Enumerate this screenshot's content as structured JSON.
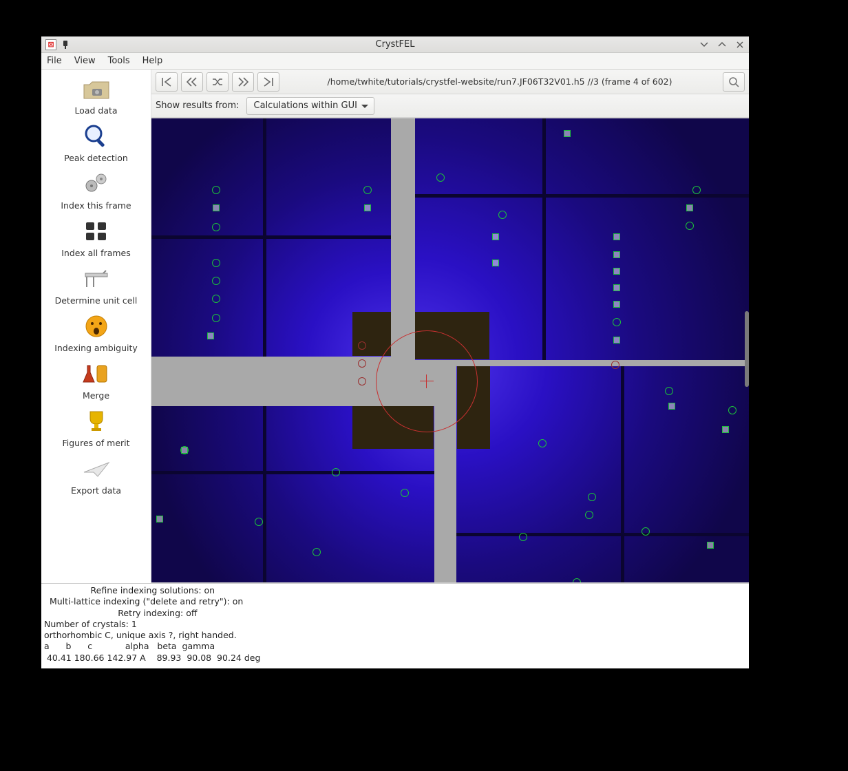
{
  "window": {
    "title": "CrystFEL"
  },
  "menu": {
    "file": "File",
    "view": "View",
    "tools": "Tools",
    "help": "Help"
  },
  "sidebar": {
    "load": "Load data",
    "peak": "Peak detection",
    "index_frame": "Index this frame",
    "index_all": "Index all frames",
    "unitcell": "Determine unit cell",
    "ambiguity": "Indexing ambiguity",
    "merge": "Merge",
    "figmerit": "Figures of merit",
    "export": "Export data"
  },
  "toolbar": {
    "path": "/home/twhite/tutorials/crystfel-website/run7.JF06T32V01.h5 //3 (frame 4 of 602)"
  },
  "resultsbar": {
    "label": "Show results from:",
    "value": "Calculations within GUI"
  },
  "log": {
    "l1": "                 Refine indexing solutions: on",
    "l2": "  Multi-lattice indexing (\"delete and retry\"): on",
    "l3": "                           Retry indexing: off",
    "l4": "Number of crystals: 1",
    "l5": "orthorhombic C, unique axis ?, right handed.",
    "l6": "a      b      c            alpha   beta  gamma",
    "l7": " 40.41 180.66 142.97 A    89.93  90.08  90.24 deg"
  }
}
